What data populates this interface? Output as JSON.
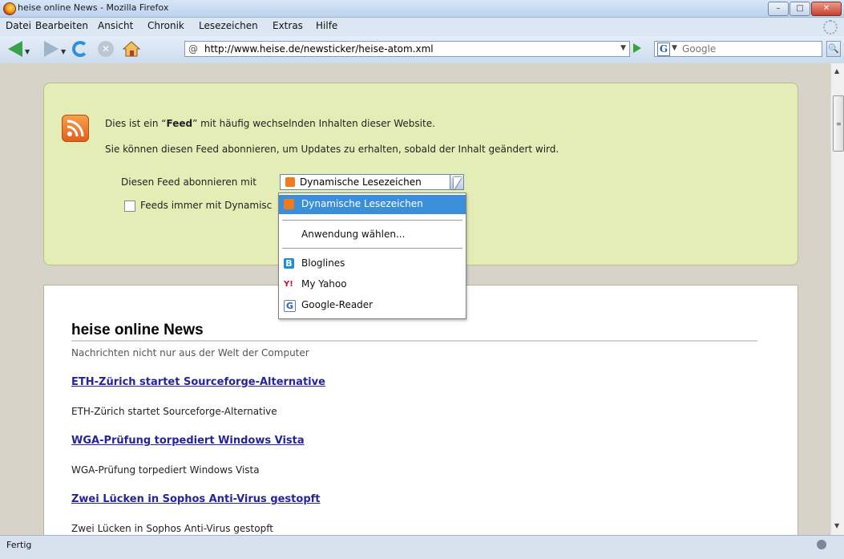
{
  "window": {
    "title": "heise online News - Mozilla Firefox"
  },
  "menubar": {
    "items": [
      "Datei",
      "Bearbeiten",
      "Ansicht",
      "Chronik",
      "Lesezeichen",
      "Extras",
      "Hilfe"
    ]
  },
  "navbar": {
    "url": "http://www.heise.de/newsticker/heise-atom.xml",
    "search_placeholder": "Google"
  },
  "feed": {
    "intro_before": "Dies ist ein “",
    "intro_bold": "Feed",
    "intro_after": "” mit häufig wechselnden Inhalten dieser Website.",
    "desc": "Sie können diesen Feed abonnieren, um Updates zu erhalten, sobald der Inhalt geändert wird.",
    "subscribe_label": "Diesen Feed abonnieren mit",
    "selected": "Dynamische Lesezeichen",
    "checkbox_label": "Feeds immer mit Dynamisc",
    "options": {
      "dynamic": "Dynamische Lesezeichen",
      "choose_app": "Anwendung wählen...",
      "bloglines": "Bloglines",
      "myyahoo": "My Yahoo",
      "google": "Google-Reader"
    }
  },
  "articles": {
    "title": "heise online News",
    "subtitle": "Nachrichten nicht nur aus der Welt der Computer",
    "items": [
      {
        "link": "ETH-Zürich startet Sourceforge-Alternative",
        "text": "ETH-Zürich startet Sourceforge-Alternative"
      },
      {
        "link": "WGA-Prüfung torpediert Windows Vista",
        "text": "WGA-Prüfung torpediert Windows Vista"
      },
      {
        "link": "Zwei Lücken in Sophos Anti-Virus gestopft",
        "text": "Zwei Lücken in Sophos Anti-Virus gestopft"
      }
    ]
  },
  "status": {
    "text": "Fertig"
  },
  "colors": {
    "feed_box": "#e5edb7",
    "selected_item": "#3b8fd9",
    "link": "#25249a"
  }
}
